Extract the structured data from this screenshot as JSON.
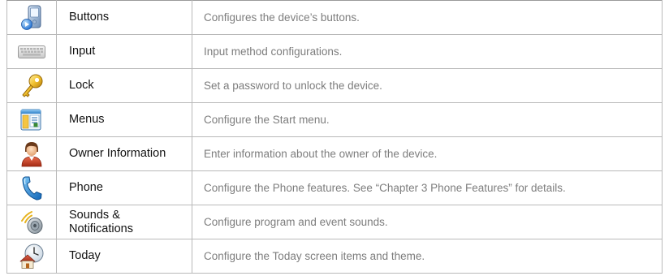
{
  "rows": [
    {
      "name": "Buttons",
      "description": "Configures the device’s buttons.",
      "icon": "buttons-device-icon"
    },
    {
      "name": "Input",
      "description": "Input method configurations.",
      "icon": "keyboard-icon"
    },
    {
      "name": "Lock",
      "description": "Set a password to unlock the device.",
      "icon": "key-icon"
    },
    {
      "name": "Menus",
      "description": "Configure the Start menu.",
      "icon": "menu-window-icon"
    },
    {
      "name": "Owner Information",
      "description": "Enter information about the owner of the device.",
      "icon": "owner-person-icon"
    },
    {
      "name": "Phone",
      "description": "Configure the Phone features. See “Chapter 3 Phone Features” for details.",
      "icon": "phone-handset-icon"
    },
    {
      "name": "Sounds & Notifications",
      "description": "Configure program and event sounds.",
      "icon": "speaker-sound-icon"
    },
    {
      "name": "Today",
      "description": "Configure the Today screen items and theme.",
      "icon": "today-clock-house-icon"
    }
  ],
  "colors": {
    "border": "#b9b9b9",
    "name_text": "#111111",
    "description_text": "#7d7d7d"
  }
}
